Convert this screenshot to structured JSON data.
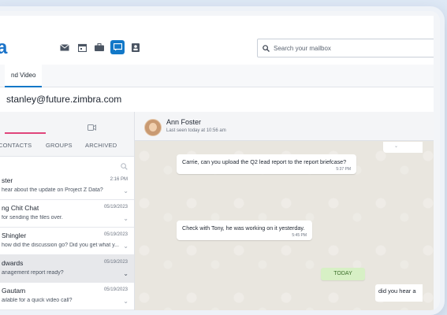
{
  "logo": "a",
  "search": {
    "placeholder": "Search your mailbox"
  },
  "tab": {
    "label": "nd Video"
  },
  "account": "stanley@future.zimbra.com",
  "left": {
    "subtabs": [
      "CONTACTS",
      "GROUPS",
      "ARCHIVED"
    ],
    "conversations": [
      {
        "name": "ster",
        "date": "2:16 PM",
        "preview": "hear about the update on Project Z Data?"
      },
      {
        "name": "ng Chit Chat",
        "date": "05/19/2023",
        "preview": "for sending the files over."
      },
      {
        "name": "Shingler",
        "date": "05/19/2023",
        "preview": "how did the discussion go? Did you get what y..."
      },
      {
        "name": "dwards",
        "date": "05/19/2023",
        "preview": "anagement report ready?"
      },
      {
        "name": "Gautam",
        "date": "05/19/2023",
        "preview": "ailable for a quick video call?"
      }
    ]
  },
  "chat": {
    "contact": "Ann Foster",
    "status": "Last seen today at 10:56 am",
    "messages": [
      {
        "text": "Carrie, can you upload the Q2 lead report to the report briefcase?",
        "time": "5:37 PM"
      },
      {
        "text": "Check with Tony, he was working on it yesterday.",
        "time": "5:45 PM"
      }
    ],
    "today_label": "TODAY",
    "partial_message": "did you hear a"
  },
  "colors": {
    "accent": "#1278c8",
    "pink": "#e0457b",
    "today_bg": "#d7f0c5"
  }
}
